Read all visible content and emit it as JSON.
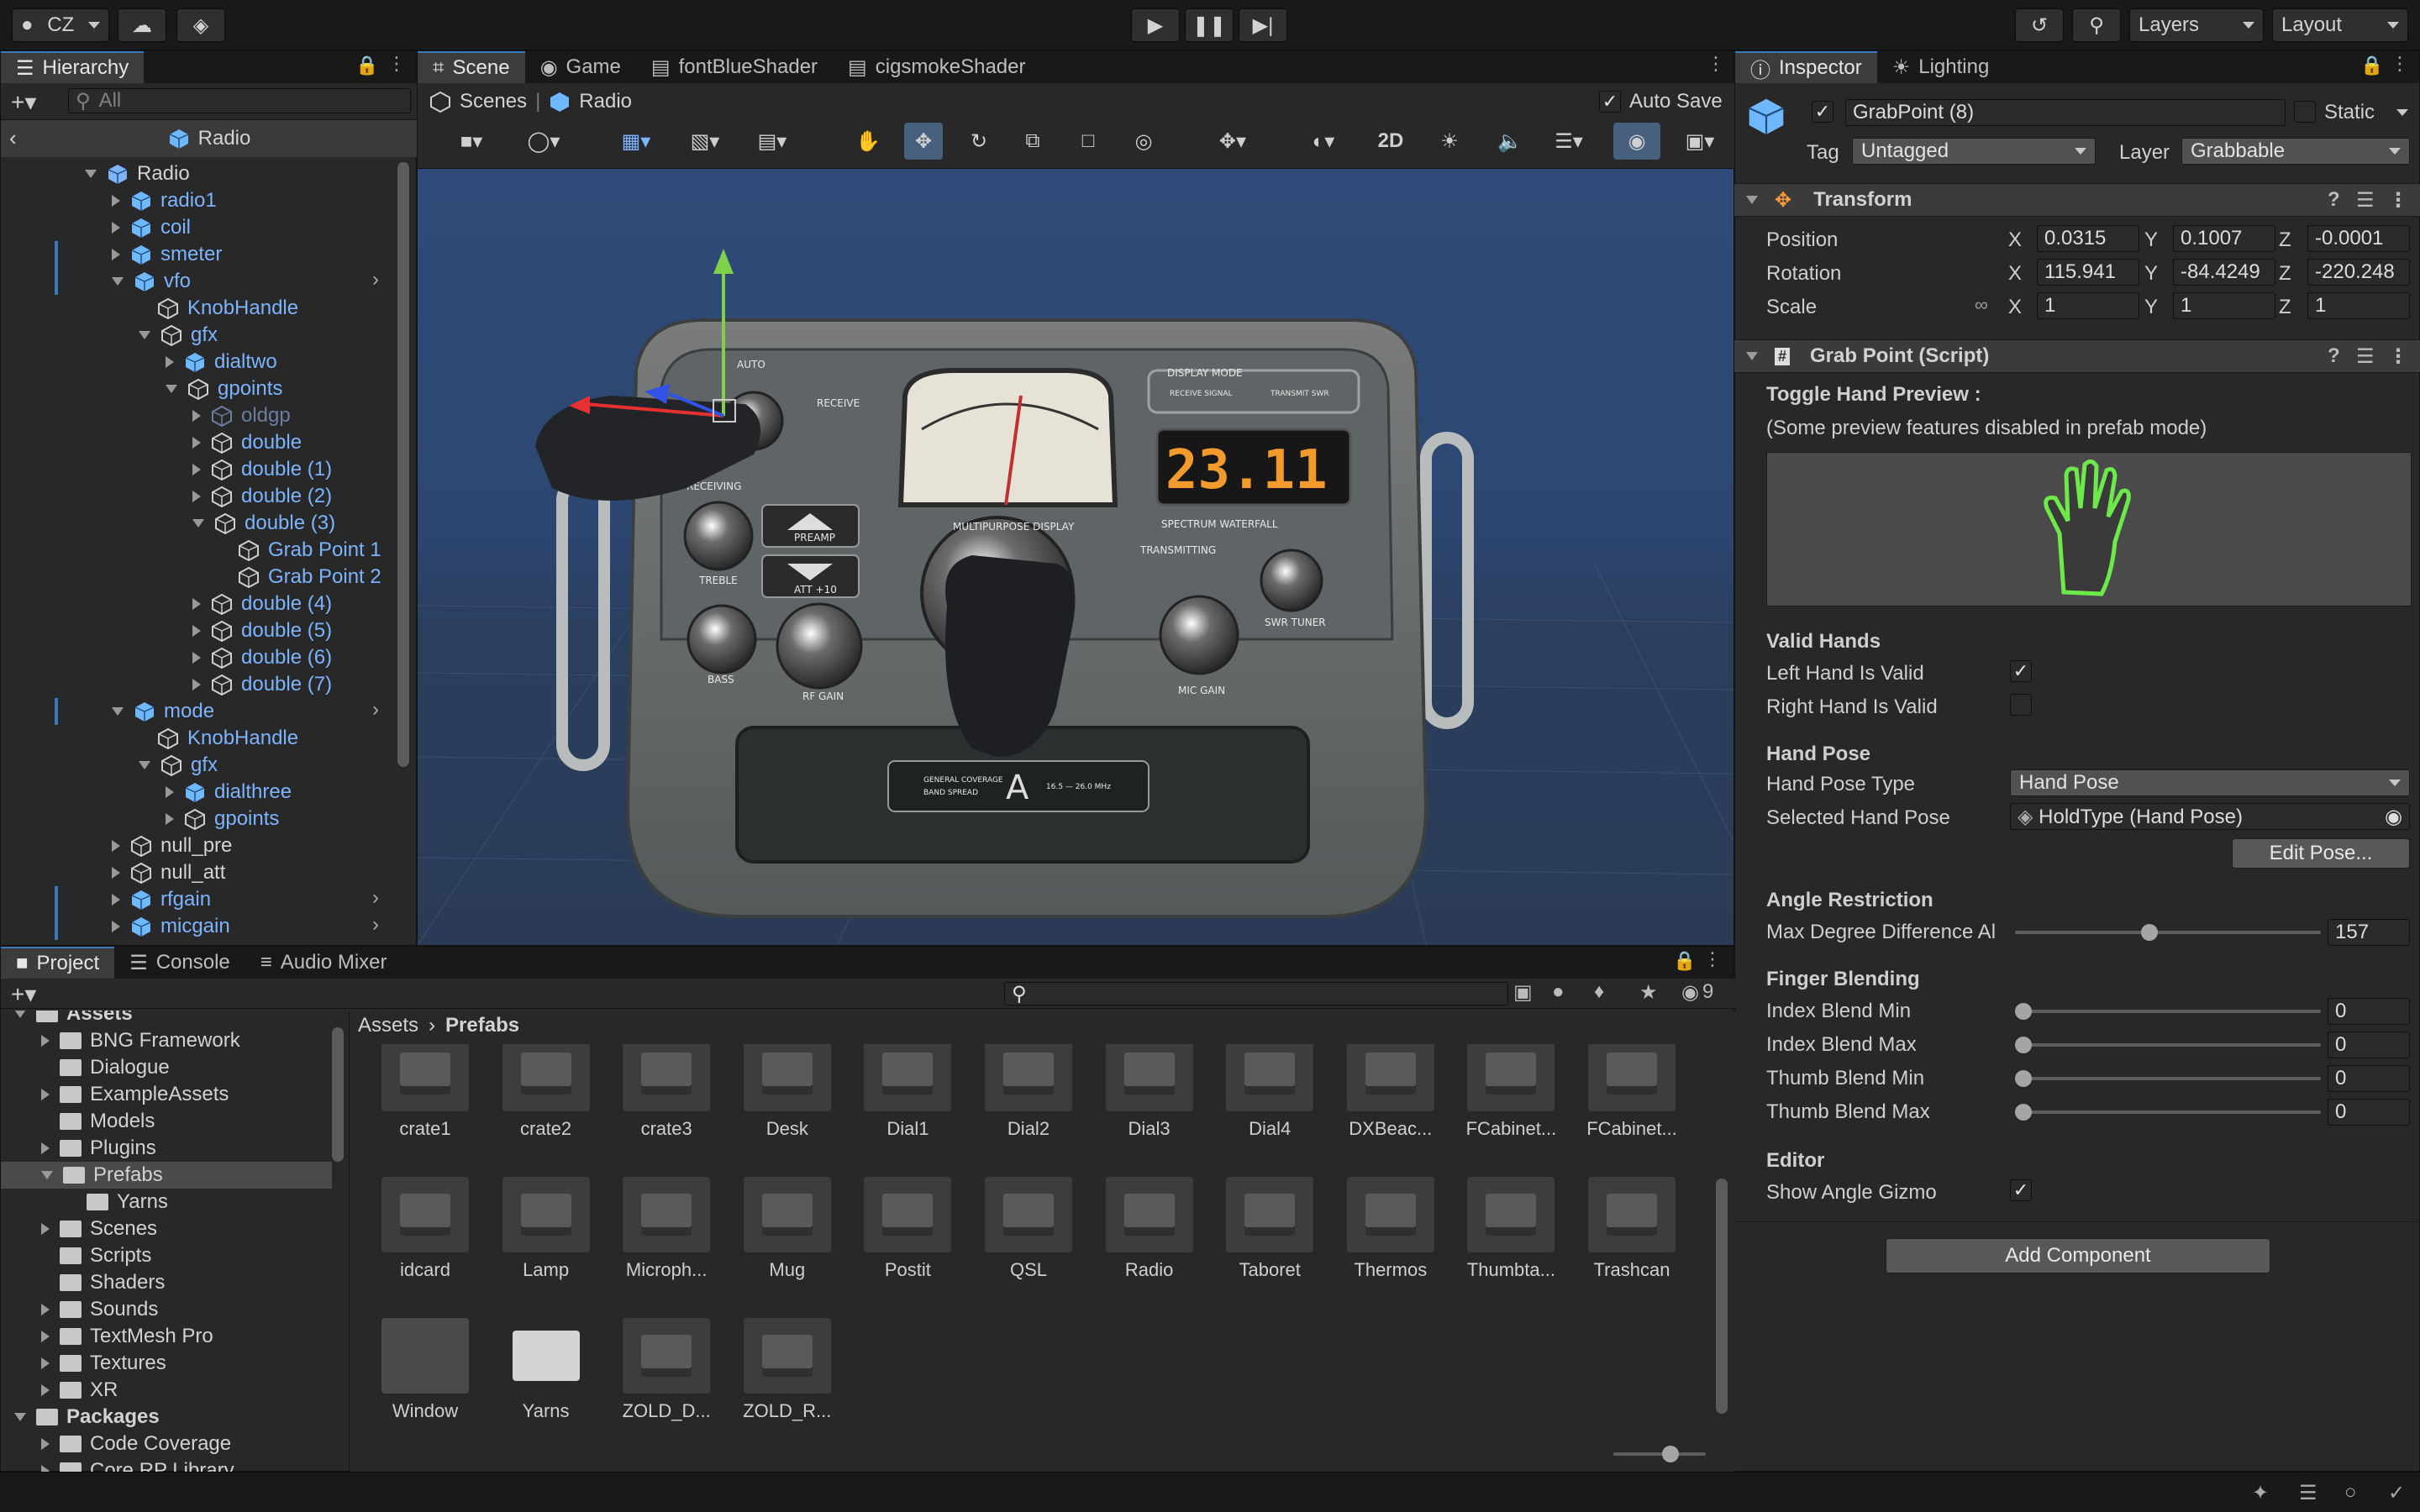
{
  "toolbar": {
    "account": "CZ",
    "layers": "Layers",
    "layout": "Layout"
  },
  "hierarchy": {
    "tab": "Hierarchy",
    "search_placeholder": "All",
    "root": "Radio",
    "items": [
      {
        "label": "Radio",
        "indent": 0,
        "arrow": "d",
        "type": "prefab-root",
        "color": "white"
      },
      {
        "label": "radio1",
        "indent": 1,
        "arrow": "r",
        "type": "prefab",
        "color": "blue"
      },
      {
        "label": "coil",
        "indent": 1,
        "arrow": "r",
        "type": "prefab",
        "color": "blue"
      },
      {
        "label": "smeter",
        "indent": 1,
        "arrow": "r",
        "type": "prefab",
        "color": "blue"
      },
      {
        "label": "vfo",
        "indent": 1,
        "arrow": "d",
        "type": "prefab",
        "color": "blue"
      },
      {
        "label": "KnobHandle",
        "indent": 2,
        "arrow": "n",
        "type": "object",
        "color": "blue"
      },
      {
        "label": "gfx",
        "indent": 2,
        "arrow": "d",
        "type": "object",
        "color": "blue"
      },
      {
        "label": "dialtwo",
        "indent": 3,
        "arrow": "r",
        "type": "prefab",
        "color": "blue"
      },
      {
        "label": "gpoints",
        "indent": 3,
        "arrow": "d",
        "type": "object",
        "color": "blue"
      },
      {
        "label": "oldgp",
        "indent": 4,
        "arrow": "r",
        "type": "object",
        "color": "dim"
      },
      {
        "label": "double",
        "indent": 4,
        "arrow": "r",
        "type": "object",
        "color": "blue"
      },
      {
        "label": "double (1)",
        "indent": 4,
        "arrow": "r",
        "type": "object",
        "color": "blue"
      },
      {
        "label": "double (2)",
        "indent": 4,
        "arrow": "r",
        "type": "object",
        "color": "blue"
      },
      {
        "label": "double (3)",
        "indent": 4,
        "arrow": "d",
        "type": "object",
        "color": "blue"
      },
      {
        "label": "Grab Point 1",
        "indent": 5,
        "arrow": "n",
        "type": "object",
        "color": "blue"
      },
      {
        "label": "Grab Point 2",
        "indent": 5,
        "arrow": "n",
        "type": "object",
        "color": "blue"
      },
      {
        "label": "double (4)",
        "indent": 4,
        "arrow": "r",
        "type": "object",
        "color": "blue"
      },
      {
        "label": "double (5)",
        "indent": 4,
        "arrow": "r",
        "type": "object",
        "color": "blue"
      },
      {
        "label": "double (6)",
        "indent": 4,
        "arrow": "r",
        "type": "object",
        "color": "blue"
      },
      {
        "label": "double (7)",
        "indent": 4,
        "arrow": "r",
        "type": "object",
        "color": "blue"
      },
      {
        "label": "mode",
        "indent": 1,
        "arrow": "d",
        "type": "prefab",
        "color": "blue"
      },
      {
        "label": "KnobHandle",
        "indent": 2,
        "arrow": "n",
        "type": "object",
        "color": "blue"
      },
      {
        "label": "gfx",
        "indent": 2,
        "arrow": "d",
        "type": "object",
        "color": "blue"
      },
      {
        "label": "dialthree",
        "indent": 3,
        "arrow": "r",
        "type": "prefab",
        "color": "blue"
      },
      {
        "label": "gpoints",
        "indent": 3,
        "arrow": "r",
        "type": "object",
        "color": "blue"
      },
      {
        "label": "null_pre",
        "indent": 1,
        "arrow": "r",
        "type": "object",
        "color": "white"
      },
      {
        "label": "null_att",
        "indent": 1,
        "arrow": "r",
        "type": "object",
        "color": "white"
      },
      {
        "label": "rfgain",
        "indent": 1,
        "arrow": "r",
        "type": "prefab",
        "color": "blue"
      },
      {
        "label": "micgain",
        "indent": 1,
        "arrow": "r",
        "type": "prefab",
        "color": "blue"
      }
    ]
  },
  "scene": {
    "tabs": [
      "Scene",
      "Game",
      "fontBlueShader",
      "cigsmokeShader"
    ],
    "breadcrumb_scenes": "Scenes",
    "breadcrumb_prefab": "Radio",
    "auto_save": "Auto Save",
    "btn_2d": "2D",
    "radio_labels": {
      "auto": "AUTO",
      "receive": "RECEIVE",
      "receiving": "RECEIVING",
      "preamp": "PREAMP",
      "att": "ATT +10",
      "treble": "TREBLE",
      "bass": "BASS",
      "rf_gain": "RF GAIN",
      "multipurpose": "MULTIPURPOSE DISPLAY",
      "display_mode": "DISPLAY MODE",
      "receive_signal": "RECEIVE SIGNAL",
      "transmit_swr": "TRANSMIT SWR",
      "freq": "23.11",
      "spectrum": "SPECTRUM WATERFALL",
      "transmitting": "TRANSMITTING",
      "mic_gain": "MIC GAIN",
      "swr_tuner": "SWR TUNER",
      "band_letter": "A",
      "coverage": "GENERAL COVERAGE",
      "spread": "BAND SPREAD",
      "mhz": "16.5 — 26.0 MHz"
    }
  },
  "inspector": {
    "tabs": [
      "Inspector",
      "Lighting"
    ],
    "object_name": "GrabPoint (8)",
    "static_label": "Static",
    "tag_label": "Tag",
    "tag_value": "Untagged",
    "layer_label": "Layer",
    "layer_value": "Grabbable",
    "transform_title": "Transform",
    "position_label": "Position",
    "rotation_label": "Rotation",
    "scale_label": "Scale",
    "position": {
      "x": "0.0315",
      "y": "0.1007",
      "z": "-0.0001"
    },
    "rotation": {
      "x": "115.941",
      "y": "-84.4249",
      "z": "-220.248"
    },
    "scale": {
      "x": "1",
      "y": "1",
      "z": "1"
    },
    "script_title": "Grab Point (Script)",
    "toggle_preview": "Toggle Hand Preview :",
    "preview_note": "(Some preview features disabled in prefab mode)",
    "valid_hands": "Valid Hands",
    "left_hand": "Left Hand Is Valid",
    "right_hand": "Right Hand Is Valid",
    "hand_pose": "Hand Pose",
    "hand_pose_type_label": "Hand Pose Type",
    "hand_pose_type": "Hand Pose",
    "selected_pose_label": "Selected Hand Pose",
    "selected_pose": "HoldType (Hand Pose)",
    "edit_pose": "Edit Pose...",
    "angle_restriction": "Angle Restriction",
    "max_degree_label": "Max Degree Difference Al",
    "max_degree": "157",
    "max_degree_fraction": 0.44,
    "finger_blending": "Finger Blending",
    "index_min_label": "Index Blend Min",
    "index_max_label": "Index Blend Max",
    "thumb_min_label": "Thumb Blend Min",
    "thumb_max_label": "Thumb Blend Max",
    "index_min": "0",
    "index_max": "0",
    "thumb_min": "0",
    "thumb_max": "0",
    "editor": "Editor",
    "show_gizmo": "Show Angle Gizmo",
    "add_component": "Add Component"
  },
  "project": {
    "tabs": [
      "Project",
      "Console",
      "Audio Mixer"
    ],
    "hidden_count": "9",
    "breadcrumb_root": "Assets",
    "breadcrumb_current": "Prefabs",
    "tree": [
      {
        "label": "Assets",
        "indent": 0,
        "arrow": "d",
        "bold": true
      },
      {
        "label": "BNG Framework",
        "indent": 1,
        "arrow": "r"
      },
      {
        "label": "Dialogue",
        "indent": 1,
        "arrow": "n"
      },
      {
        "label": "ExampleAssets",
        "indent": 1,
        "arrow": "r"
      },
      {
        "label": "Models",
        "indent": 1,
        "arrow": "n"
      },
      {
        "label": "Plugins",
        "indent": 1,
        "arrow": "r"
      },
      {
        "label": "Prefabs",
        "indent": 1,
        "arrow": "d",
        "selected": true
      },
      {
        "label": "Yarns",
        "indent": 2,
        "arrow": "n"
      },
      {
        "label": "Scenes",
        "indent": 1,
        "arrow": "r"
      },
      {
        "label": "Scripts",
        "indent": 1,
        "arrow": "n"
      },
      {
        "label": "Shaders",
        "indent": 1,
        "arrow": "n"
      },
      {
        "label": "Sounds",
        "indent": 1,
        "arrow": "r"
      },
      {
        "label": "TextMesh Pro",
        "indent": 1,
        "arrow": "r"
      },
      {
        "label": "Textures",
        "indent": 1,
        "arrow": "r"
      },
      {
        "label": "XR",
        "indent": 1,
        "arrow": "r"
      },
      {
        "label": "Packages",
        "indent": 0,
        "arrow": "d",
        "bold": true
      },
      {
        "label": "Code Coverage",
        "indent": 1,
        "arrow": "r"
      },
      {
        "label": "Core RP Library",
        "indent": 1,
        "arrow": "r"
      }
    ],
    "assets": [
      "crate1",
      "crate2",
      "crate3",
      "Desk",
      "Dial1",
      "Dial2",
      "Dial3",
      "Dial4",
      "DXBeac...",
      "FCabinet...",
      "FCabinet...",
      "idcard",
      "Lamp",
      "Microph...",
      "Mug",
      "Postit",
      "QSL",
      "Radio",
      "Taboret",
      "Thermos",
      "Thumbta...",
      "Trashcan",
      "Window",
      "Yarns",
      "ZOLD_D...",
      "ZOLD_R..."
    ]
  }
}
